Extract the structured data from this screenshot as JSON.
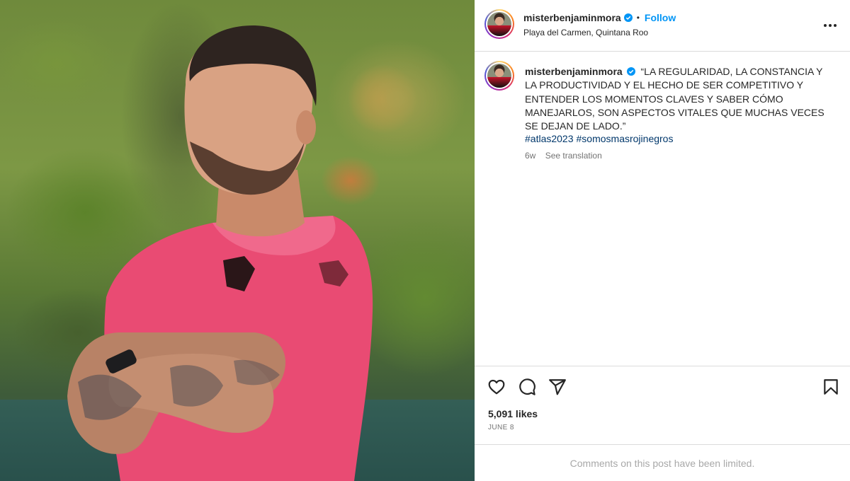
{
  "post": {
    "username": "misterbenjaminmora",
    "follow_label": "Follow",
    "separator": "•",
    "location": "Playa del Carmen, Quintana Roo",
    "caption": "“LA REGULARIDAD, LA CONSTANCIA Y LA PRODUCTIVIDAD Y EL HECHO DE SER COMPETITIVO Y ENTENDER LOS MOMENTOS CLAVES Y SABER CÓMO MANEJARLOS, SON ASPECTOS VITALES QUE MUCHAS VECES SE DEJAN DE LADO.”",
    "hashtags": [
      "#atlas2023",
      "#somosmasrojinegros"
    ],
    "time_ago": "6w",
    "see_translation": "See translation",
    "likes": "5,091 likes",
    "date": "JUNE 8",
    "comments_notice": "Comments on this post have been limited."
  },
  "icons": {
    "verified": "verified-badge-icon",
    "more": "more-options-icon",
    "like": "heart-icon",
    "comment": "comment-icon",
    "share": "share-icon",
    "save": "bookmark-icon"
  },
  "colors": {
    "link_blue": "#0095f6",
    "hashtag_blue": "#00376b",
    "muted": "#737373",
    "divider": "#dbdbdb",
    "shirt_pink": "#e84a72"
  }
}
